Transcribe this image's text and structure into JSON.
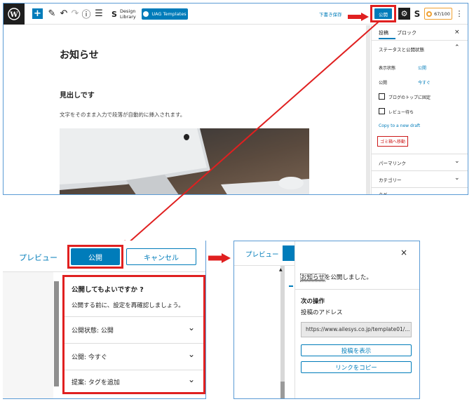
{
  "editor": {
    "toolbar": {
      "design_library_line1": "Design",
      "design_library_line2": "Library",
      "uag_templates": "UAG Templates",
      "save_draft": "下書き保存",
      "publish": "公開",
      "score": "67/100"
    },
    "content": {
      "title": "お知らせ",
      "heading": "見出しです",
      "paragraph": "文字をそのまま入力で段落が自動的に挿入されます。"
    },
    "sidebar": {
      "tabs": [
        "投稿",
        "ブロック"
      ],
      "section_status": "ステータスと公開状態",
      "visibility_label": "表示状態",
      "visibility_value": "公開",
      "publish_label": "公開",
      "publish_value": "今すぐ",
      "stick_to_top": "ブログのトップに固定",
      "pending_review": "レビュー待ち",
      "copy_to_draft": "Copy to a new draft",
      "move_to_trash": "ゴミ箱へ移動",
      "permalink": "パーマリンク",
      "category": "カテゴリー",
      "tags_partial": "タグ"
    }
  },
  "prepublish": {
    "preview": "プレビュー",
    "publish": "公開",
    "cancel": "キャンセル",
    "question": "公開してもよいですか ?",
    "description": "公開する前に、設定を再確認しましょう。",
    "rows": [
      {
        "label": "公開状態: 公開"
      },
      {
        "label": "公開: 今すぐ"
      },
      {
        "label": "提案: タグを追加"
      }
    ]
  },
  "postpublish": {
    "preview": "プレビュー",
    "post_link": "お知らせ",
    "published_suffix": "を公開しました。",
    "next_actions": "次の操作",
    "post_address": "投稿のアドレス",
    "url": "https://www.ailesys.co.jp/template01/...",
    "view_post": "投稿を表示",
    "copy_link": "リンクをコピー"
  },
  "colors": {
    "accent": "#007cba",
    "annotation_red": "#e02020",
    "score_orange": "#f0a030"
  }
}
